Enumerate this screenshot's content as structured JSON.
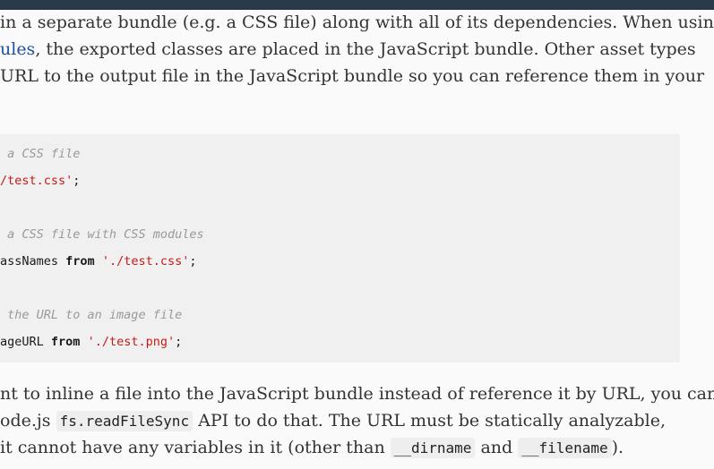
{
  "paragraph_top": {
    "line1": "in a separate bundle (e.g. a CSS file) along with all of its dependencies. When using",
    "line2_link": "ules",
    "line2_rest": ", the exported classes are placed in the JavaScript bundle. Other asset types",
    "line3": "URL to the output file in the JavaScript bundle so you can reference them in your"
  },
  "code": {
    "comment1": "a CSS file",
    "line1_str": "/test.css'",
    "line1_punct": ";",
    "comment2": "a CSS file with CSS modules",
    "line2_ident": "assNames",
    "line2_kw": "from",
    "line2_str": "'./test.css'",
    "line2_punct": ";",
    "comment3": "the URL to an image file",
    "line3_ident": "ageURL",
    "line3_kw": "from",
    "line3_str": "'./test.png'",
    "line3_punct": ";"
  },
  "paragraph_bottom": {
    "line1": "nt to inline a file into the JavaScript bundle instead of reference it by URL, you can",
    "line2_pre": "ode.js",
    "line2_code": "fs.readFileSync",
    "line2_post": "API to do that. The URL must be statically analyzable,",
    "line3_pre": "it cannot have any variables in it (other than",
    "line3_code1": "__dirname",
    "line3_mid": "and",
    "line3_code2": "__filename",
    "line3_post": ")."
  }
}
